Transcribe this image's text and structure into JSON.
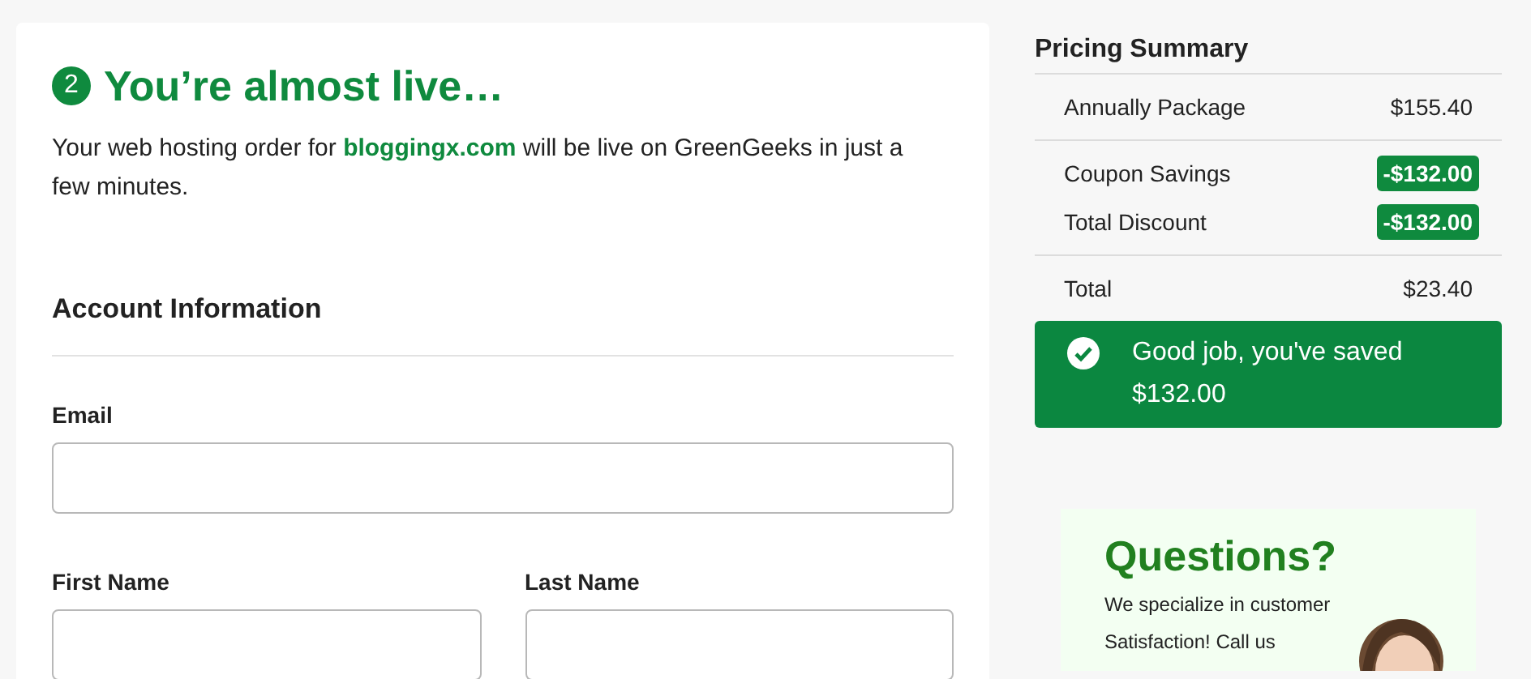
{
  "step": {
    "number": "2",
    "title": "You’re almost live…"
  },
  "intro": "Your web hosting order for **bloggingx.com** will be live on GreenGeeks in just a few minutes.",
  "account": {
    "heading": "Account Information",
    "fields": [
      {
        "label": "Email",
        "kind": "wide"
      },
      {
        "label": "First Name",
        "kind": "narrow"
      },
      {
        "label": "Last Name",
        "kind": "narrow"
      }
    ]
  },
  "pricing_summary": {
    "title": "Pricing Summary",
    "groups": [
      [
        {
          "label": "Annually Package",
          "amount": "$155.40",
          "kind": "plain"
        }
      ],
      [
        {
          "label": "Coupon Savings",
          "amount": "-$132.00",
          "kind": "discount"
        },
        {
          "label": "Total Discount",
          "amount": "-$132.00",
          "kind": "discount"
        }
      ],
      [
        {
          "label": "Total",
          "amount": "$23.40",
          "kind": "plain"
        }
      ]
    ],
    "savings_message": "Good job, you've saved $132.00"
  },
  "questions_banner": {
    "title": "Questions?",
    "lines": [
      "We specialize in customer",
      "Satisfaction! Call us"
    ]
  }
}
